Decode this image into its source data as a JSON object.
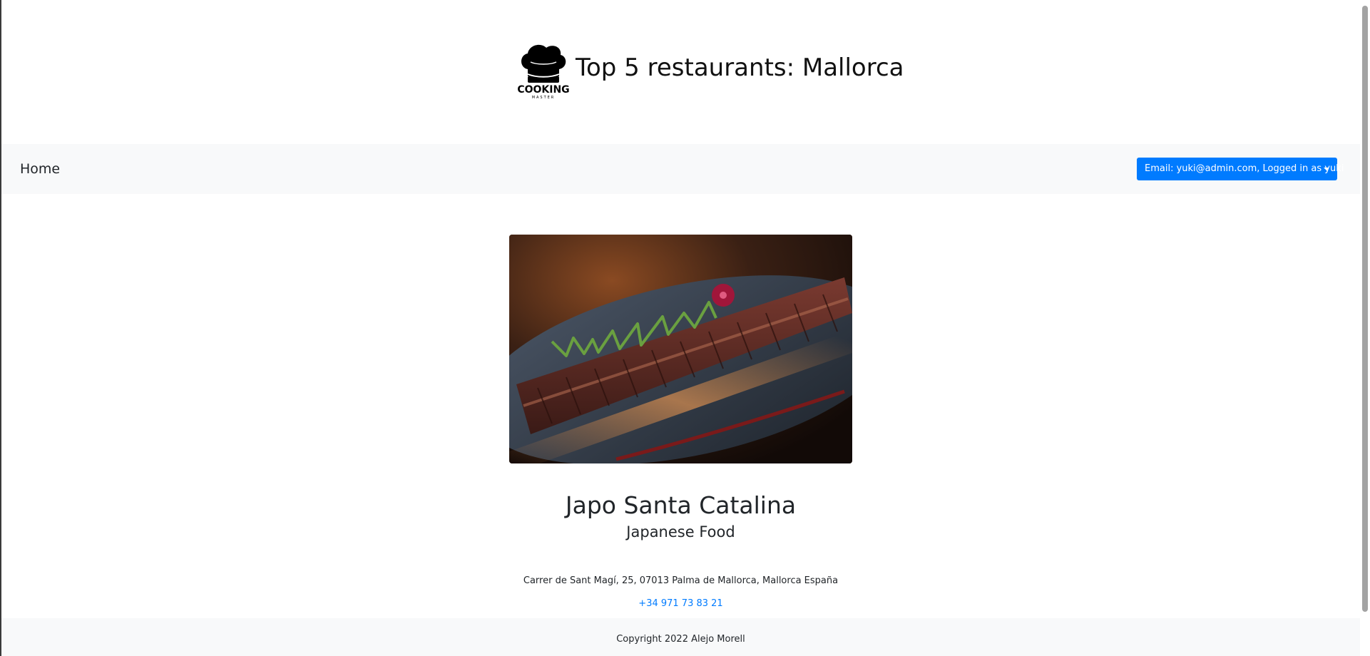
{
  "header": {
    "title": "Top 5 restaurants: Mallorca",
    "logo_text": "COOKING",
    "logo_subtext": "MASTER"
  },
  "navbar": {
    "home_label": "Home",
    "user_dropdown_label": "Email: yuki@admin.com, Logged in as yuki"
  },
  "restaurant": {
    "name": "Japo Santa Catalina",
    "cuisine": "Japanese Food",
    "address": "Carrer de Sant Magí, 25, 07013 Palma de Mallorca, Mallorca España",
    "phone": "+34 971 73 83 21"
  },
  "footer": {
    "copyright": "Copyright 2022 Alejo Morell"
  },
  "colors": {
    "accent": "#007bff",
    "navbar_bg": "#f8f9fa",
    "text": "#212529"
  },
  "icons": {
    "logo": "chef-hat-icon",
    "dropdown": "caret-down-icon"
  }
}
